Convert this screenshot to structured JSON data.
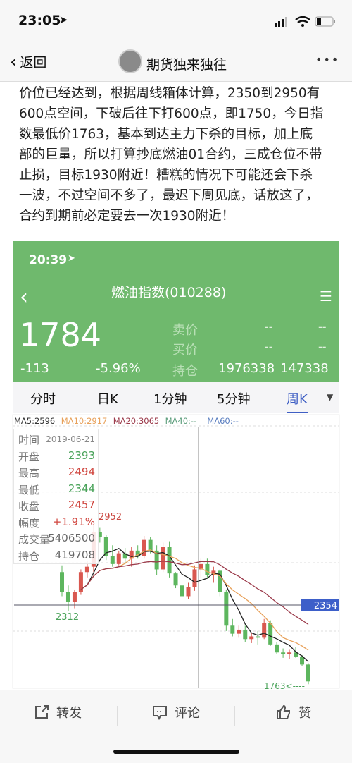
{
  "status_bar": {
    "time": "23:05"
  },
  "nav": {
    "back_label": "返回",
    "title": "期货独来独往",
    "more": "•••"
  },
  "post": {
    "lines": [
      "价位已经达到，根据周线箱体计算，2350到2950有",
      "600点空间，下破后往下打600点，即1750，今日指",
      "数最低价1763，基本到达主力下杀的目标，加上底",
      "部的巨量，所以打算抄底燃油01合约，三成仓位不带",
      "止损，目标1930附近！糟糕的情况下可能还会下杀",
      "一波，不过空间不多了，最迟下周见底，话放这了，",
      "合约到期前必定要去一次1930附近！"
    ]
  },
  "quote": {
    "time": "20:39",
    "title": "燃油指数(010288)",
    "price": "1784",
    "change": "-113",
    "change_pct": "-5.96%",
    "sell_label": "卖价",
    "buy_label": "买价",
    "oi_label": "持仓",
    "sell_1": "--",
    "sell_2": "--",
    "buy_1": "--",
    "buy_2": "--",
    "oi_1": "1976338",
    "oi_2": "147338",
    "bg_color": "#6fb96d"
  },
  "tabs": [
    {
      "label": "分时"
    },
    {
      "label": "日K"
    },
    {
      "label": "1分钟"
    },
    {
      "label": "5分钟"
    },
    {
      "label": "周K",
      "selected": true
    }
  ],
  "ma_legend": [
    {
      "label": "MA5:2596",
      "color": "#333333"
    },
    {
      "label": "MA10:2917",
      "color": "#e8a15a"
    },
    {
      "label": "MA20:3065",
      "color": "#9b3a4a"
    },
    {
      "label": "MA40:--",
      "color": "#5a9c7a"
    },
    {
      "label": "MA60:--",
      "color": "#5b7fc0"
    }
  ],
  "info_box": [
    {
      "k": "时间",
      "v": "2019-06-21",
      "c": "#888"
    },
    {
      "k": "开盘",
      "v": "2393",
      "c": "#4aa35a"
    },
    {
      "k": "最高",
      "v": "2494",
      "c": "#d0463f"
    },
    {
      "k": "最低",
      "v": "2344",
      "c": "#4aa35a"
    },
    {
      "k": "收盘",
      "v": "2457",
      "c": "#d0463f"
    },
    {
      "k": "幅度",
      "v": "+1.91%",
      "c": "#d0463f"
    },
    {
      "k": "成交量",
      "v": "5406500",
      "c": "#666"
    },
    {
      "k": "持仓",
      "v": "419708",
      "c": "#666"
    }
  ],
  "chart_data": {
    "type": "candlestick",
    "crosshair_price": "2354",
    "max_label": "2952",
    "min_label_left": "2312",
    "min_label_right": "1763<----",
    "ohlc": [
      [
        2600,
        2650,
        2420,
        2450
      ],
      [
        2450,
        2500,
        2312,
        2380
      ],
      [
        2380,
        2470,
        2330,
        2450
      ],
      [
        2450,
        2620,
        2430,
        2600
      ],
      [
        2600,
        2680,
        2560,
        2640
      ],
      [
        2640,
        2952,
        2600,
        2900
      ],
      [
        2900,
        2930,
        2820,
        2860
      ],
      [
        2860,
        2880,
        2690,
        2720
      ],
      [
        2720,
        2800,
        2640,
        2660
      ],
      [
        2660,
        2760,
        2650,
        2740
      ],
      [
        2740,
        2780,
        2660,
        2700
      ],
      [
        2700,
        2790,
        2640,
        2760
      ],
      [
        2760,
        2800,
        2700,
        2720
      ],
      [
        2720,
        2870,
        2700,
        2840
      ],
      [
        2840,
        2860,
        2740,
        2760
      ],
      [
        2760,
        2800,
        2580,
        2620
      ],
      [
        2620,
        2820,
        2600,
        2790
      ],
      [
        2790,
        2830,
        2560,
        2590
      ],
      [
        2590,
        2600,
        2480,
        2500
      ],
      [
        2500,
        2510,
        2390,
        2420
      ],
      [
        2420,
        2520,
        2400,
        2490
      ],
      [
        2490,
        2650,
        2460,
        2620
      ],
      [
        2620,
        2700,
        2560,
        2660
      ],
      [
        2660,
        2700,
        2560,
        2580
      ],
      [
        2580,
        2640,
        2520,
        2610
      ],
      [
        2610,
        2620,
        2420,
        2450
      ],
      [
        2450,
        2470,
        2160,
        2200
      ],
      [
        2200,
        2250,
        2120,
        2140
      ],
      [
        2140,
        2200,
        2110,
        2170
      ],
      [
        2170,
        2200,
        2080,
        2100
      ],
      [
        2100,
        2150,
        2070,
        2120
      ],
      [
        2120,
        2160,
        2060,
        2110
      ],
      [
        2110,
        2250,
        2100,
        2220
      ],
      [
        2220,
        2240,
        2050,
        2060
      ],
      [
        2060,
        2080,
        1990,
        2000
      ],
      [
        2000,
        2030,
        1960,
        1990
      ],
      [
        1990,
        2020,
        1950,
        2000
      ],
      [
        2000,
        2040,
        1960,
        1970
      ],
      [
        1970,
        1980,
        1900,
        1910
      ],
      [
        1910,
        1920,
        1763,
        1784
      ]
    ],
    "up_color": "#d9574f",
    "down_color": "#5db65e"
  },
  "actions": {
    "share": "转发",
    "comment": "评论",
    "like": "赞"
  }
}
